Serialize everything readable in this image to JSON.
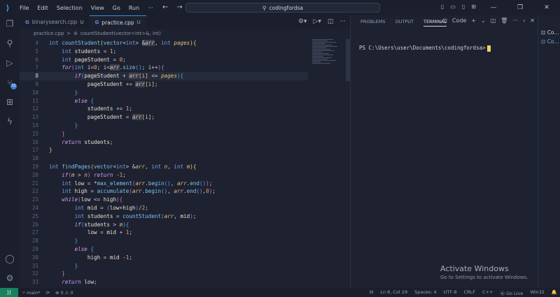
{
  "titlebar": {
    "menu": [
      "File",
      "Edit",
      "Selection",
      "View",
      "Go",
      "Run"
    ],
    "more": "···",
    "search_text": "codingfordsa",
    "win_controls": [
      "—",
      "❐",
      "✕"
    ]
  },
  "tabs": [
    {
      "name": "binarysearch.cpp",
      "status": "U",
      "active": false
    },
    {
      "name": "practice.cpp",
      "status": "U",
      "active": true
    }
  ],
  "breadcrumb": {
    "file": "practice.cpp",
    "sep": ">",
    "symbol": "countStudent(vector<int>&, int)"
  },
  "editor": {
    "current_line": "8",
    "lines": [
      {
        "n": "4"
      },
      {
        "n": "5"
      },
      {
        "n": "6"
      },
      {
        "n": "7"
      },
      {
        "n": "8"
      },
      {
        "n": "9"
      },
      {
        "n": "10"
      },
      {
        "n": "11"
      },
      {
        "n": "12"
      },
      {
        "n": "13"
      },
      {
        "n": "14"
      },
      {
        "n": "15"
      },
      {
        "n": "16"
      },
      {
        "n": "17"
      },
      {
        "n": "18"
      },
      {
        "n": "19"
      },
      {
        "n": "20"
      },
      {
        "n": "21"
      },
      {
        "n": "22"
      },
      {
        "n": "23"
      },
      {
        "n": "24"
      },
      {
        "n": "25"
      },
      {
        "n": "26"
      },
      {
        "n": "27"
      },
      {
        "n": "28"
      },
      {
        "n": "29"
      },
      {
        "n": "30"
      },
      {
        "n": "31"
      },
      {
        "n": "32"
      },
      {
        "n": "33"
      }
    ]
  },
  "panel": {
    "tabs": [
      "PROBLEMS",
      "OUTPUT",
      "TERMINAL"
    ],
    "active_tab": "TERMINAL",
    "shell_label": "Code",
    "prompt": "PS C:\\Users\\user\\Documents\\codingfordsa>",
    "activate_title": "Activate Windows",
    "activate_sub": "Go to Settings to activate Windows."
  },
  "terminal_list": [
    "Co...",
    "Co..."
  ],
  "statusbar": {
    "branch": "main*",
    "errors": "⊗ 0 ⚠ 0",
    "position": "Ln 8, Col 29",
    "spaces": "Spaces: 4",
    "encoding": "UTF-8",
    "eol": "CRLF",
    "language": "C++",
    "golive": "Go Live",
    "platform": "Win32"
  },
  "colors": {
    "accent": "#3a8fd6",
    "background": "#1e2230",
    "remote": "#16825d"
  }
}
